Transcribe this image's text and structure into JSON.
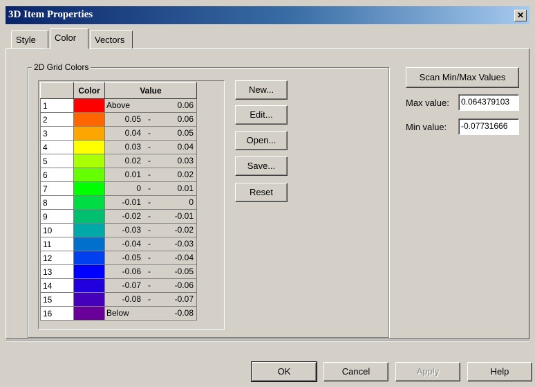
{
  "window": {
    "title": "3D Item Properties",
    "close_glyph": "✕"
  },
  "tabs": [
    {
      "label": "Style",
      "active": false
    },
    {
      "label": "Color",
      "active": true
    },
    {
      "label": "Vectors",
      "active": false
    }
  ],
  "group": {
    "label": "2D Grid Colors"
  },
  "grid": {
    "headers": {
      "index": "",
      "color": "Color",
      "value": "Value"
    },
    "rows": [
      {
        "n": "1",
        "color": "#ff0000",
        "low": "Above",
        "dash": "",
        "high": "0.06"
      },
      {
        "n": "2",
        "color": "#ff6600",
        "low": "0.05",
        "dash": "-",
        "high": "0.06"
      },
      {
        "n": "3",
        "color": "#ffa500",
        "low": "0.04",
        "dash": "-",
        "high": "0.05"
      },
      {
        "n": "4",
        "color": "#ffff00",
        "low": "0.03",
        "dash": "-",
        "high": "0.04"
      },
      {
        "n": "5",
        "color": "#aaff00",
        "low": "0.02",
        "dash": "-",
        "high": "0.03"
      },
      {
        "n": "6",
        "color": "#66ff00",
        "low": "0.01",
        "dash": "-",
        "high": "0.02"
      },
      {
        "n": "7",
        "color": "#00ff00",
        "low": "0",
        "dash": "-",
        "high": "0.01"
      },
      {
        "n": "8",
        "color": "#00dd44",
        "low": "-0.01",
        "dash": "-",
        "high": "0"
      },
      {
        "n": "9",
        "color": "#00c070",
        "low": "-0.02",
        "dash": "-",
        "high": "-0.01"
      },
      {
        "n": "10",
        "color": "#00a8a8",
        "low": "-0.03",
        "dash": "-",
        "high": "-0.02"
      },
      {
        "n": "11",
        "color": "#0070cc",
        "low": "-0.04",
        "dash": "-",
        "high": "-0.03"
      },
      {
        "n": "12",
        "color": "#0040ee",
        "low": "-0.05",
        "dash": "-",
        "high": "-0.04"
      },
      {
        "n": "13",
        "color": "#0000ff",
        "low": "-0.06",
        "dash": "-",
        "high": "-0.05"
      },
      {
        "n": "14",
        "color": "#2200dd",
        "low": "-0.07",
        "dash": "-",
        "high": "-0.06"
      },
      {
        "n": "15",
        "color": "#4400bb",
        "low": "-0.08",
        "dash": "-",
        "high": "-0.07"
      },
      {
        "n": "16",
        "color": "#6a0099",
        "low": "Below",
        "dash": "",
        "high": "-0.08"
      }
    ]
  },
  "side_buttons": {
    "new": "New...",
    "edit": "Edit...",
    "open": "Open...",
    "save": "Save...",
    "reset": "Reset"
  },
  "scan": {
    "button": "Scan Min/Max Values",
    "max_label": "Max value:",
    "max_value": "0.064379103",
    "min_label": "Min value:",
    "min_value": "-0.07731666"
  },
  "footer": {
    "ok": "OK",
    "cancel": "Cancel",
    "apply": "Apply",
    "help": "Help"
  }
}
